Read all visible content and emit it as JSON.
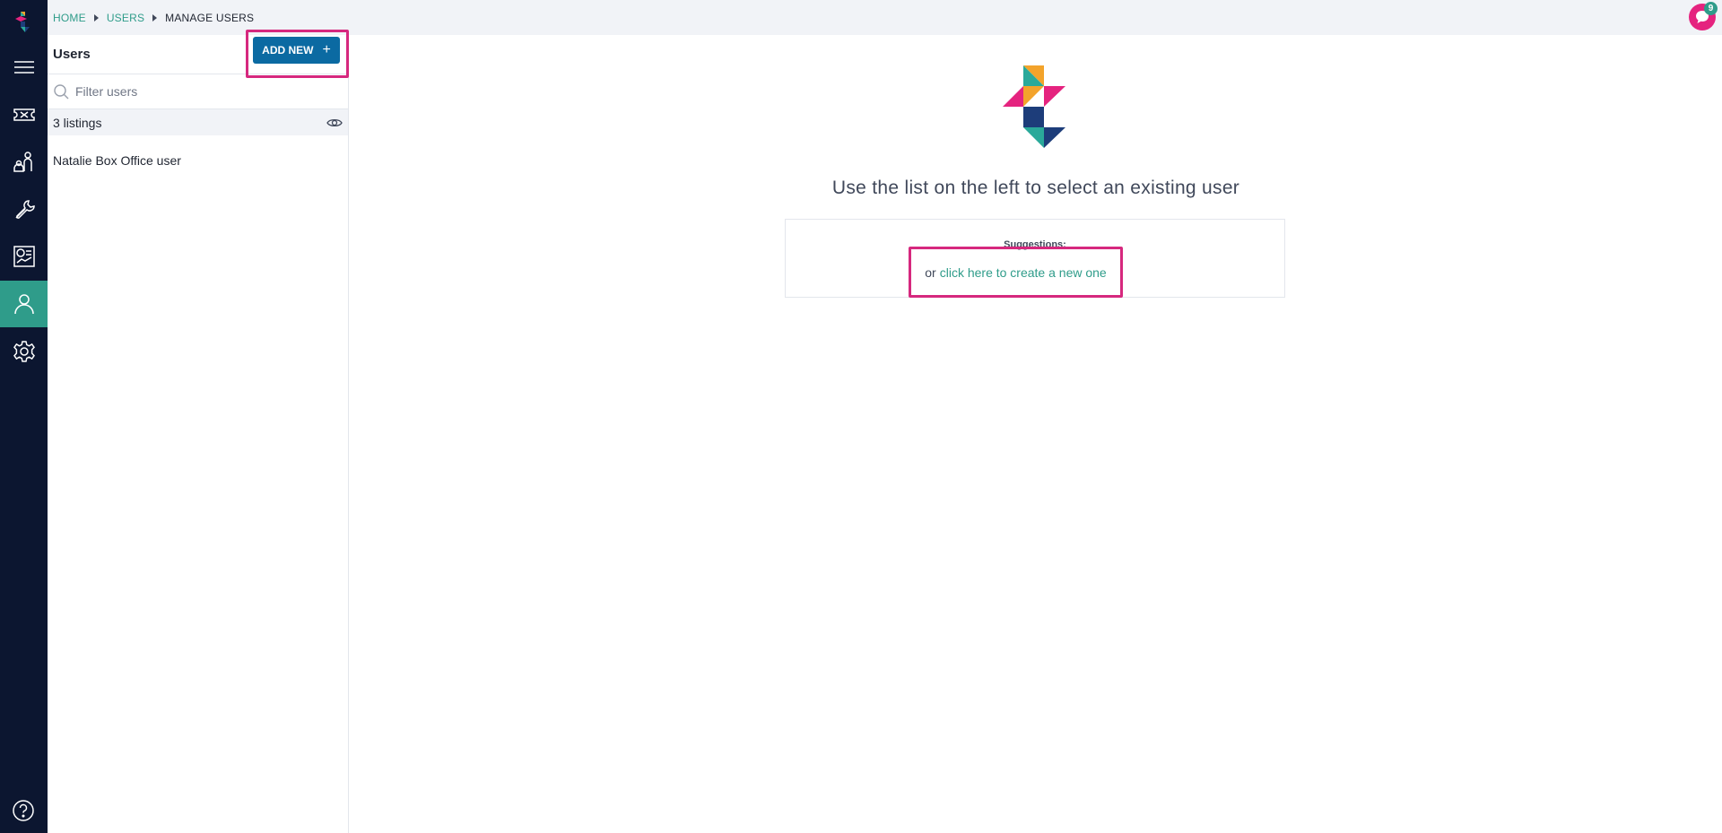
{
  "breadcrumb": {
    "items": [
      {
        "label": "HOME",
        "link": true
      },
      {
        "label": "USERS",
        "link": true
      },
      {
        "label": "MANAGE USERS",
        "link": false
      }
    ]
  },
  "notifications": {
    "count": "9"
  },
  "sidebar": {
    "items": [
      {
        "name": "menu",
        "icon": "hamburger-icon",
        "active": false
      },
      {
        "name": "tickets",
        "icon": "ticket-icon",
        "active": false
      },
      {
        "name": "customers",
        "icon": "people-icon",
        "active": false
      },
      {
        "name": "tools",
        "icon": "wrench-icon",
        "active": false
      },
      {
        "name": "reports",
        "icon": "report-icon",
        "active": false
      },
      {
        "name": "users",
        "icon": "user-icon",
        "active": true
      },
      {
        "name": "settings",
        "icon": "gear-icon",
        "active": false
      }
    ],
    "help_icon": "help-icon"
  },
  "users_panel": {
    "title": "Users",
    "add_new_label": "ADD NEW",
    "add_new_icon": "plus-icon",
    "filter_placeholder": "Filter users",
    "listings_label": "3 listings",
    "users": [
      {
        "name": "Natalie Box Office user"
      }
    ]
  },
  "main": {
    "empty_title": "Use the list on the left to select an existing user",
    "suggestions_label": "Suggestions:",
    "suggestion_prefix": "or",
    "suggestion_link": "click here to create a new one"
  },
  "colors": {
    "rail": "#0c1630",
    "accent_teal": "#2f9c8a",
    "primary_button": "#0b6aa2",
    "highlight_pink": "#d6287e",
    "topbar": "#f1f3f7"
  }
}
